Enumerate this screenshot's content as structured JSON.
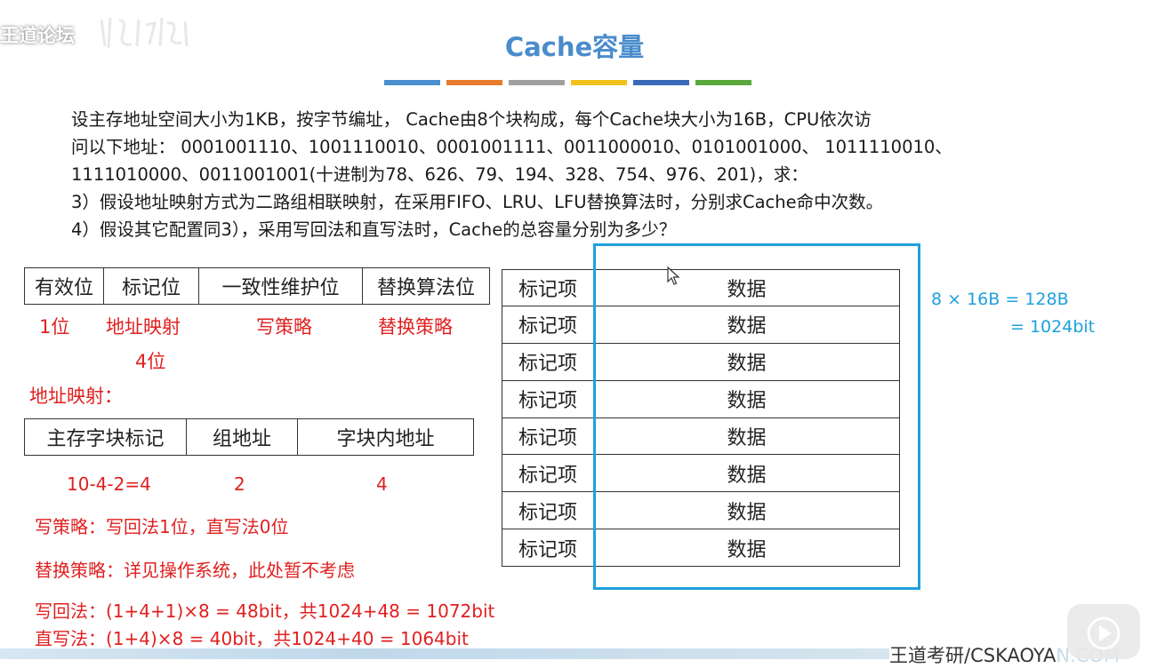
{
  "watermark": {
    "top_left": "王道论坛",
    "bottom_right_main": "王道考研/CSKAOYA",
    "bottom_right_fade": "N.COM"
  },
  "title": "Cache容量",
  "accent_bars": [
    "#4a90d0",
    "#e87b2c",
    "#a0a0a0",
    "#f2c21a",
    "#3a6bb8",
    "#5aa83c"
  ],
  "question": {
    "line1": "设主存地址空间大小为1KB，按字节编址， Cache由8个块构成，每个Cache块大小为16B，CPU依次访",
    "line2": "问以下地址： 0001001110、1001110010、0001001111、0011000010、0101001000、 1011110010、",
    "line3": "1111010000、0011001001(十进制为78、626、79、194、328、754、976、201)，求：",
    "line4": "3）假设地址映射方式为二路组相联映射，在采用FIFO、LRU、LFU替换算法时，分别求Cache命中次数。",
    "line5": "4）假设其它配置同3），采用写回法和直写法时，Cache的总容量分别为多少？"
  },
  "tag_fields": [
    "有效位",
    "标记位",
    "一致性维护位",
    "替换算法位"
  ],
  "tag_notes": {
    "valid": "1位",
    "tag": "地址映射",
    "tag_bits": "4位",
    "coherence": "写策略",
    "replace": "替换策略"
  },
  "address_mapping_label": "地址映射：",
  "address_fields": [
    "主存字块标记",
    "组地址",
    "字块内地址"
  ],
  "address_bits": [
    "10-4-2=4",
    "2",
    "4"
  ],
  "notes": {
    "write_policy": "写策略：写回法1位，直写法0位",
    "replace_policy": "替换策略：详见操作系统，此处暂不考虑",
    "write_back": "写回法：(1+4+1)×8 = 48bit，共1024+48 = 1072bit",
    "write_through": "直写法：(1+4)×8 = 40bit，共1024+40 = 1064bit"
  },
  "cache_lines": [
    {
      "tag": "标记项",
      "data": "数据"
    },
    {
      "tag": "标记项",
      "data": "数据"
    },
    {
      "tag": "标记项",
      "data": "数据"
    },
    {
      "tag": "标记项",
      "data": "数据"
    },
    {
      "tag": "标记项",
      "data": "数据"
    },
    {
      "tag": "标记项",
      "data": "数据"
    },
    {
      "tag": "标记项",
      "data": "数据"
    },
    {
      "tag": "标记项",
      "data": "数据"
    }
  ],
  "capacity": {
    "line1": "8 × 16B = 128B",
    "line2": "= 1024bit"
  },
  "colors": {
    "title": "#4a8ccc",
    "red": "#e02020",
    "blue": "#1ea0dc"
  }
}
